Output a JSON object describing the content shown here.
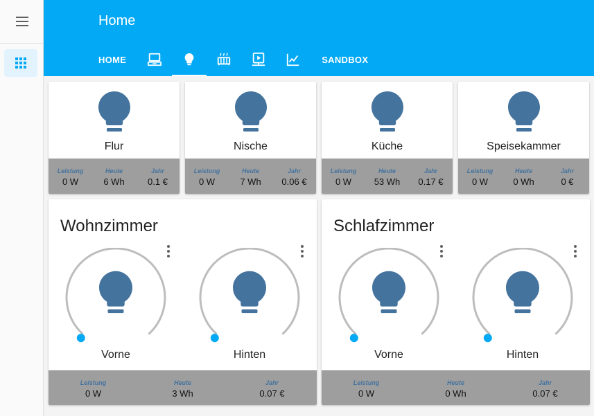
{
  "header": {
    "title": "Home",
    "tabs": [
      {
        "type": "text",
        "label": "HOME",
        "icon": "",
        "active": false
      },
      {
        "type": "icon",
        "label": "",
        "icon": "laptop-icon",
        "active": false
      },
      {
        "type": "icon",
        "label": "",
        "icon": "lightbulb-icon",
        "active": true
      },
      {
        "type": "icon",
        "label": "",
        "icon": "radiator-icon",
        "active": false
      },
      {
        "type": "icon",
        "label": "",
        "icon": "media-player-icon",
        "active": false
      },
      {
        "type": "icon",
        "label": "",
        "icon": "chart-line-icon",
        "active": false
      },
      {
        "type": "text",
        "label": "SANDBOX",
        "icon": "",
        "active": false
      }
    ]
  },
  "sidebar": {
    "menu_icon": "hamburger-icon",
    "active_item_icon": "grid-icon"
  },
  "colors": {
    "accent": "#03a9f4",
    "bulb_off": "#44739e",
    "stats_bg": "#9e9e9e",
    "dial_track": "#bdbdbd"
  },
  "lights": [
    {
      "name": "Flur",
      "stats": [
        {
          "label": "Leistung",
          "value": "0 W"
        },
        {
          "label": "Heute",
          "value": "6 Wh"
        },
        {
          "label": "Jahr",
          "value": "0.1 €"
        }
      ]
    },
    {
      "name": "Nische",
      "stats": [
        {
          "label": "Leistung",
          "value": "0 W"
        },
        {
          "label": "Heute",
          "value": "7 Wh"
        },
        {
          "label": "Jahr",
          "value": "0.06 €"
        }
      ]
    },
    {
      "name": "Küche",
      "stats": [
        {
          "label": "Leistung",
          "value": "0 W"
        },
        {
          "label": "Heute",
          "value": "53 Wh"
        },
        {
          "label": "Jahr",
          "value": "0.17 €"
        }
      ]
    },
    {
      "name": "Speisekammer",
      "stats": [
        {
          "label": "Leistung",
          "value": "0 W"
        },
        {
          "label": "Heute",
          "value": "0 Wh"
        },
        {
          "label": "Jahr",
          "value": "0 €"
        }
      ]
    }
  ],
  "rooms": [
    {
      "title": "Wohnzimmer",
      "lights": [
        {
          "name": "Vorne",
          "brightness": 0
        },
        {
          "name": "Hinten",
          "brightness": 0
        }
      ],
      "stats": [
        {
          "label": "Leistung",
          "value": "0 W"
        },
        {
          "label": "Heute",
          "value": "3 Wh"
        },
        {
          "label": "Jahr",
          "value": "0.07 €"
        }
      ]
    },
    {
      "title": "Schlafzimmer",
      "lights": [
        {
          "name": "Vorne",
          "brightness": 0
        },
        {
          "name": "Hinten",
          "brightness": 0
        }
      ],
      "stats": [
        {
          "label": "Leistung",
          "value": "0 W"
        },
        {
          "label": "Heute",
          "value": "0 Wh"
        },
        {
          "label": "Jahr",
          "value": "0.07 €"
        }
      ]
    }
  ]
}
